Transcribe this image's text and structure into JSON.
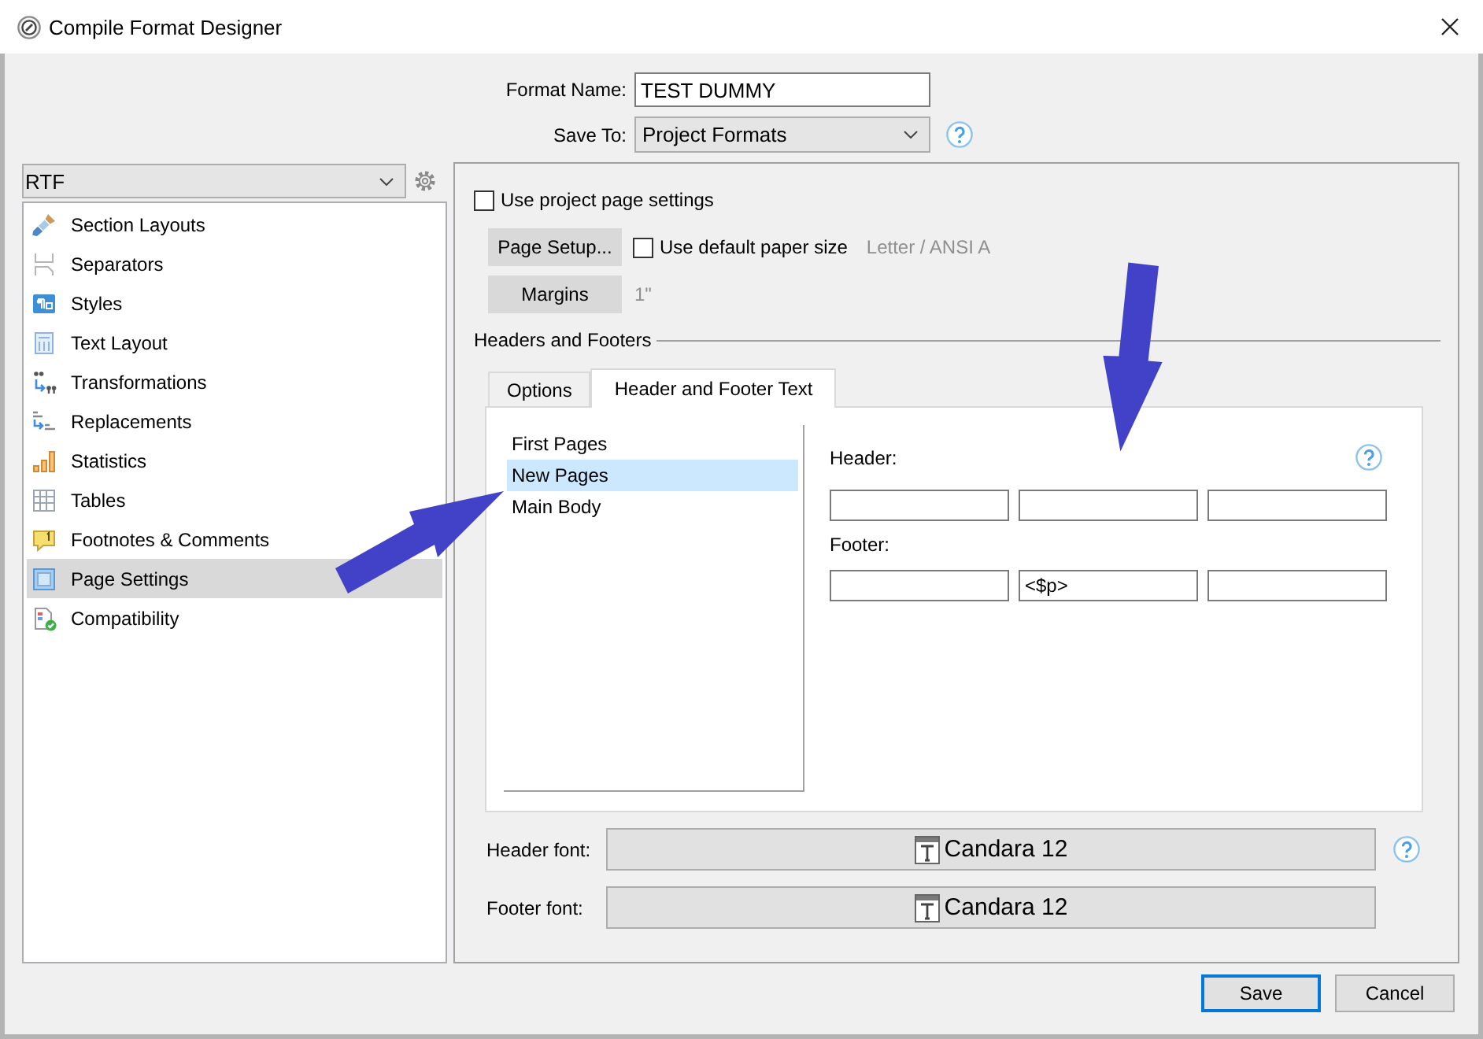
{
  "window": {
    "title": "Compile Format Designer"
  },
  "format_name": {
    "label": "Format Name:",
    "value": "TEST DUMMY"
  },
  "save_to": {
    "label": "Save To:",
    "value": "Project Formats"
  },
  "format_type": {
    "value": "RTF"
  },
  "sidebar": {
    "items": [
      {
        "label": "Section Layouts",
        "selected": false
      },
      {
        "label": "Separators",
        "selected": false
      },
      {
        "label": "Styles",
        "selected": false
      },
      {
        "label": "Text Layout",
        "selected": false
      },
      {
        "label": "Transformations",
        "selected": false
      },
      {
        "label": "Replacements",
        "selected": false
      },
      {
        "label": "Statistics",
        "selected": false
      },
      {
        "label": "Tables",
        "selected": false
      },
      {
        "label": "Footnotes & Comments",
        "selected": false
      },
      {
        "label": "Page Settings",
        "selected": true
      },
      {
        "label": "Compatibility",
        "selected": false
      }
    ]
  },
  "page_settings": {
    "use_project_settings": {
      "label": "Use project page settings",
      "checked": false
    },
    "page_setup": {
      "button": "Page Setup...",
      "checkbox_label": "Use default paper size",
      "checked": false,
      "paper_size": "Letter / ANSI A"
    },
    "margins": {
      "button": "Margins",
      "value": "1\""
    }
  },
  "headers_and_footers": {
    "title": "Headers and Footers",
    "tabs": [
      {
        "label": "Options",
        "selected": false
      },
      {
        "label": "Header and Footer Text",
        "selected": true
      }
    ],
    "page_types": [
      {
        "label": "First Pages",
        "selected": false
      },
      {
        "label": "New Pages",
        "selected": true
      },
      {
        "label": "Main Body",
        "selected": false
      }
    ],
    "header": {
      "label": "Header:"
    },
    "footer": {
      "label": "Footer:",
      "middle_field": "<$p>"
    },
    "header_font": {
      "label": "Header font:",
      "value": "Candara 12"
    },
    "footer_font": {
      "label": "Footer font:",
      "value": "Candara 12"
    }
  },
  "buttons": [
    {
      "label": "Save",
      "default": true
    },
    {
      "label": "Cancel",
      "default": false
    }
  ]
}
